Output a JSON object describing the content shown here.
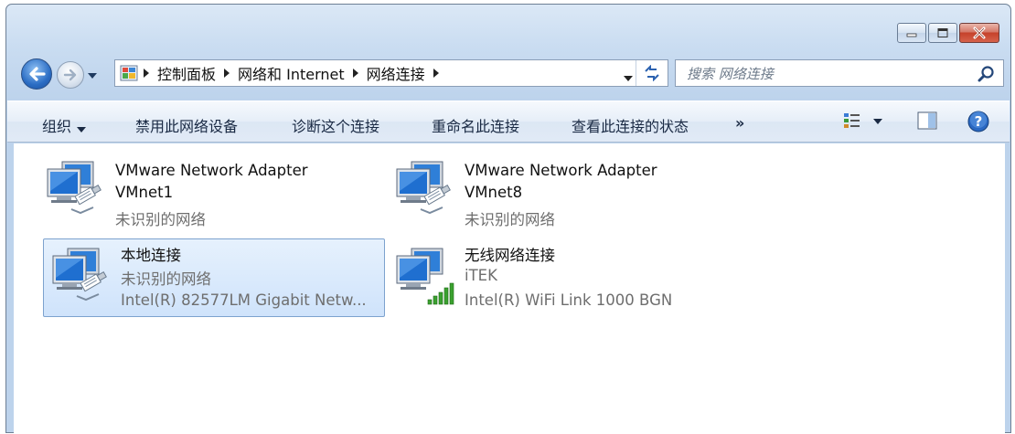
{
  "window": {
    "caption_buttons": [
      "minimize",
      "maximize",
      "close"
    ]
  },
  "address_bar": {
    "breadcrumbs": [
      "控制面板",
      "网络和 Internet",
      "网络连接"
    ],
    "icon": "control-panel-icon"
  },
  "search": {
    "placeholder": "搜索 网络连接"
  },
  "command_bar": {
    "organize": "组织",
    "disable": "禁用此网络设备",
    "diagnose": "诊断这个连接",
    "rename": "重命名此连接",
    "view_status": "查看此连接的状态",
    "more": "»"
  },
  "connections": [
    {
      "name": "VMware Network Adapter",
      "name2": "VMnet1",
      "status": "未识别的网络",
      "type": "wired",
      "selected": false
    },
    {
      "name": "VMware Network Adapter",
      "name2": "VMnet8",
      "status": "未识别的网络",
      "type": "wired",
      "selected": false
    },
    {
      "name": "本地连接",
      "status": "未识别的网络",
      "device": "Intel(R) 82577LM Gigabit Netw...",
      "type": "wired",
      "selected": true
    },
    {
      "name": "无线网络连接",
      "status": "iTEK",
      "device": "Intel(R) WiFi Link 1000 BGN",
      "type": "wireless",
      "selected": false
    }
  ],
  "colors": {
    "accent": "#2b6dc4",
    "selection": "#cfe3fb",
    "close": "#c5412a",
    "signal": "#3aa12f"
  }
}
